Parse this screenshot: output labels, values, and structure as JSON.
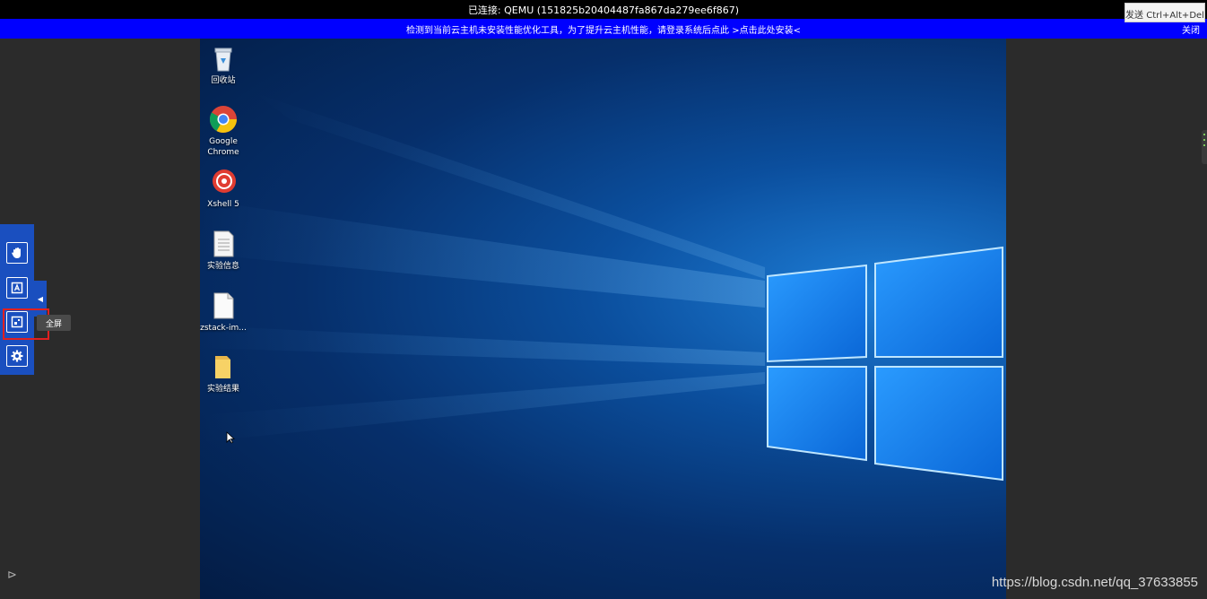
{
  "status_bar": {
    "title": "已连接: QEMU (151825b20404487fa867da279ee6f867)",
    "send_cad_label": "发送 Ctrl+Alt+Del"
  },
  "notice": {
    "text": "检测到当前云主机未安装性能优化工具，为了提升云主机性能，请登录系统后点此 >点击此处安装<",
    "close_label": "关闭"
  },
  "desktop": {
    "icons": [
      {
        "name": "recycle-bin-icon",
        "label": "回收站"
      },
      {
        "name": "chrome-icon",
        "label": "Google\nChrome"
      },
      {
        "name": "xshell-icon",
        "label": "Xshell 5"
      },
      {
        "name": "document-icon",
        "label": "实验信息"
      },
      {
        "name": "file-icon",
        "label": "zstack-im..."
      },
      {
        "name": "folder-icon",
        "label": "实验结果"
      }
    ]
  },
  "toolbar": {
    "buttons": [
      {
        "name": "hand-icon"
      },
      {
        "name": "keyboard-a-icon"
      },
      {
        "name": "fullscreen-icon"
      },
      {
        "name": "gear-icon"
      }
    ],
    "tooltip": "全屏"
  },
  "watermark": "https://blog.csdn.net/qq_37633855",
  "colors": {
    "toolbar": "#1a4fbf",
    "notice": "#0000ff",
    "highlight": "#e02020"
  }
}
